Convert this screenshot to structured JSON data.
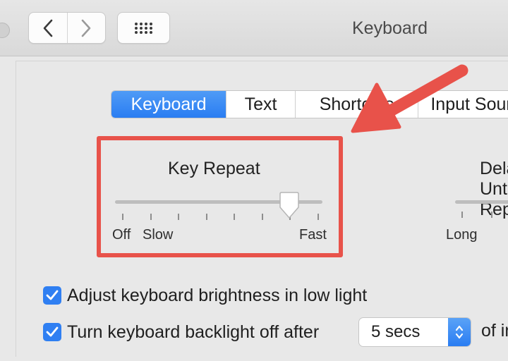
{
  "window": {
    "title": "Keyboard"
  },
  "toolbar": {
    "back_icon": "chevron-left-icon",
    "forward_icon": "chevron-right-icon",
    "grid_icon": "grid-dots-icon"
  },
  "tabs": [
    {
      "label": "Keyboard",
      "active": true
    },
    {
      "label": "Text",
      "active": false
    },
    {
      "label": "Shortcuts",
      "active": false
    },
    {
      "label": "Input Sources",
      "active": false
    }
  ],
  "key_repeat": {
    "title": "Key Repeat",
    "label_off": "Off",
    "label_slow": "Slow",
    "label_fast": "Fast",
    "tick_count": 8,
    "selected_tick": 6
  },
  "delay_until_repeat": {
    "title": "Delay Until Repeat",
    "label_long": "Long"
  },
  "options": {
    "brightness_label": "Adjust keyboard brightness in low light",
    "brightness_checked": true,
    "backlight_label": "Turn keyboard backlight off after",
    "backlight_checked": true,
    "backlight_select_value": "5 secs",
    "backlight_trailing": "of inactivity"
  },
  "annotation": {
    "highlight_color": "#e8524a"
  },
  "colors": {
    "accent": "#2a7df2",
    "highlight": "#e8524a"
  }
}
